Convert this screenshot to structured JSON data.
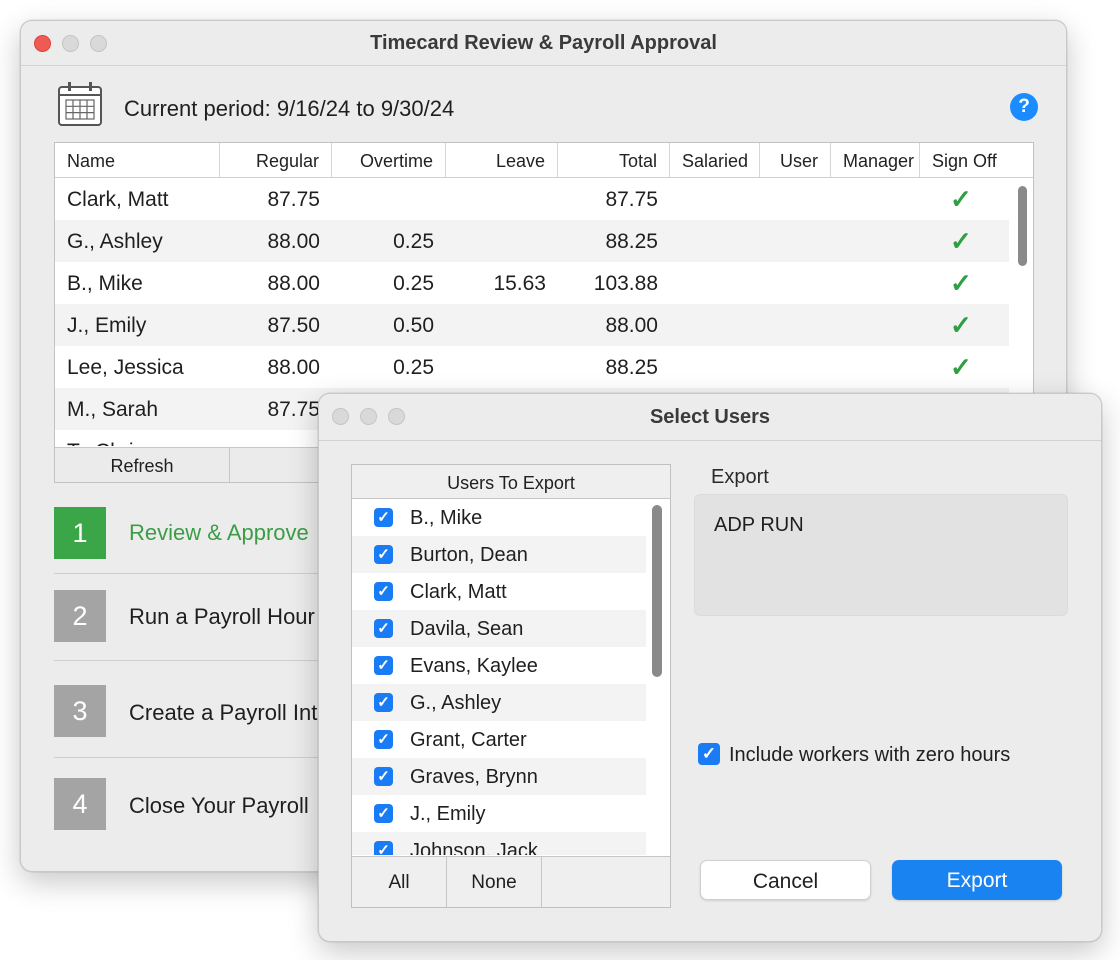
{
  "main_window": {
    "title": "Timecard Review & Payroll Approval",
    "period_text": "Current period: 9/16/24 to 9/30/24",
    "help_icon": "?",
    "columns": [
      "Name",
      "Regular",
      "Overtime",
      "Leave",
      "Total",
      "Salaried",
      "User",
      "Manager",
      "Sign Off"
    ],
    "rows": [
      {
        "name": "Clark, Matt",
        "regular": "87.75",
        "overtime": "",
        "leave": "",
        "total": "87.75",
        "signoff": "✓"
      },
      {
        "name": "G., Ashley",
        "regular": "88.00",
        "overtime": "0.25",
        "leave": "",
        "total": "88.25",
        "signoff": "✓"
      },
      {
        "name": "B., Mike",
        "regular": "88.00",
        "overtime": "0.25",
        "leave": "15.63",
        "total": "103.88",
        "signoff": "✓"
      },
      {
        "name": "J., Emily",
        "regular": "87.50",
        "overtime": "0.50",
        "leave": "",
        "total": "88.00",
        "signoff": "✓"
      },
      {
        "name": "Lee, Jessica",
        "regular": "88.00",
        "overtime": "0.25",
        "leave": "",
        "total": "88.25",
        "signoff": "✓"
      },
      {
        "name": "M., Sarah",
        "regular": "87.75",
        "overtime": "",
        "leave": "",
        "total": "",
        "signoff": ""
      },
      {
        "name": "T., Chris",
        "regular": "",
        "overtime": "",
        "leave": "",
        "total": "",
        "signoff": ""
      }
    ],
    "refresh_label": "Refresh",
    "steps": [
      {
        "number": "1",
        "label": "Review & Approve"
      },
      {
        "number": "2",
        "label": "Run a Payroll Hour"
      },
      {
        "number": "3",
        "label": "Create a Payroll Int"
      },
      {
        "number": "4",
        "label": "Close Your Payroll"
      }
    ]
  },
  "dialog": {
    "title": "Select Users",
    "users_header": "Users To Export",
    "users": [
      "B., Mike",
      "Burton, Dean",
      "Clark, Matt",
      "Davila, Sean",
      "Evans, Kaylee",
      "G., Ashley",
      "Grant, Carter",
      "Graves, Brynn",
      "J., Emily",
      "Johnson, Jack"
    ],
    "all_label": "All",
    "none_label": "None",
    "export_label": "Export",
    "export_value": "ADP RUN",
    "include_zero_label": "Include workers with zero hours",
    "include_zero_checked": true,
    "cancel_label": "Cancel",
    "export_button_label": "Export"
  },
  "colors": {
    "accent_blue": "#1a83f2",
    "active_green": "#3aa648",
    "step_gray": "#a4a4a4",
    "check_green": "#2f9e44",
    "close_red": "#ee5b53"
  }
}
